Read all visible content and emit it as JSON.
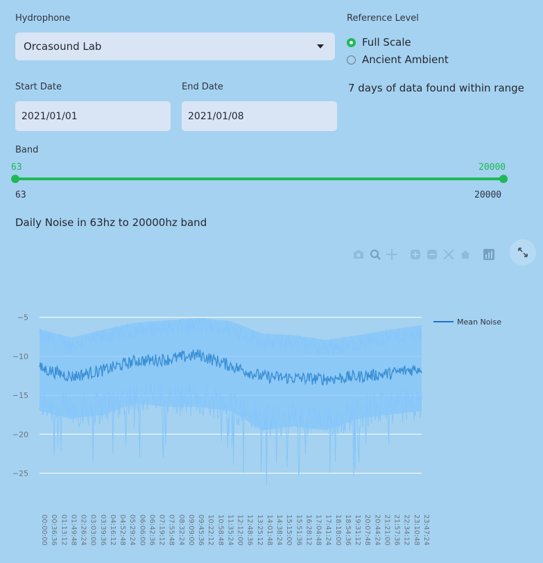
{
  "hydrophone": {
    "label": "Hydrophone",
    "selected": "Orcasound Lab"
  },
  "reference": {
    "label": "Reference Level",
    "options": [
      {
        "label": "Full Scale",
        "selected": true
      },
      {
        "label": "Ancient Ambient",
        "selected": false
      }
    ]
  },
  "dates": {
    "start_label": "Start Date",
    "start_value": "2021/01/01",
    "end_label": "End Date",
    "end_value": "2021/01/08"
  },
  "info_text": "7 days of data found within range",
  "band": {
    "label": "Band",
    "min": "63",
    "max": "20000",
    "value_low": "63",
    "value_high": "20000"
  },
  "chart_title": "Daily Noise in 63hz to 20000hz band",
  "toolbar_icons": [
    "camera-icon",
    "zoom-icon",
    "pan-icon",
    "zoom-in-icon",
    "zoom-out-icon",
    "autoscale-icon",
    "home-icon",
    "plotly-logo-icon"
  ],
  "colors": {
    "accent": "#1db954",
    "mean_line": "#3a8fd4",
    "band_fill": "#85c6f9",
    "background": "#a5d2f0"
  },
  "chart_data": {
    "type": "line",
    "legend": [
      "Mean Noise"
    ],
    "legend_position": "top-right",
    "grid": true,
    "ylim": [
      -27,
      -4.5
    ],
    "yticks": [
      -5,
      -10,
      -15,
      -20,
      -25
    ],
    "xticks": [
      "00:00:00",
      "00:36:36",
      "01:13:12",
      "01:49:48",
      "02:26:24",
      "03:03:00",
      "03:39:36",
      "04:16:12",
      "04:52:48",
      "05:29:24",
      "06:06:00",
      "06:42:36",
      "07:19:12",
      "07:55:48",
      "08:32:24",
      "09:09:00",
      "09:45:36",
      "10:22:12",
      "10:58:48",
      "11:35:24",
      "12:12:00",
      "12:48:36",
      "13:25:12",
      "14:01:48",
      "14:38:24",
      "15:15:00",
      "15:51:36",
      "16:28:12",
      "17:04:48",
      "17:41:24",
      "18:18:00",
      "18:54:36",
      "19:31:12",
      "20:07:48",
      "20:44:24",
      "21:21:00",
      "21:57:36",
      "22:34:12",
      "23:10:48",
      "23:47:24"
    ],
    "series": [
      {
        "name": "Mean Noise",
        "x": [
          0,
          2,
          4,
          6,
          8,
          10,
          12,
          14,
          16,
          18,
          20,
          22,
          24
        ],
        "values": [
          -11.5,
          -12.6,
          -11.8,
          -10.6,
          -10.4,
          -9.8,
          -11.2,
          -12.6,
          -12.8,
          -12.9,
          -12.6,
          -12.2,
          -11.5
        ]
      },
      {
        "upper": [
          -7.5,
          -8.6,
          -7.6,
          -6.7,
          -6.4,
          -6.1,
          -6.5,
          -8.1,
          -8.3,
          -8.9,
          -8.3,
          -7.6,
          -7.0
        ],
        "lower": [
          -16.0,
          -17.0,
          -16.5,
          -15.0,
          -15.5,
          -15.5,
          -16.0,
          -18.5,
          -18.0,
          -18.5,
          -17.0,
          -16.5,
          -16.0
        ]
      }
    ]
  }
}
